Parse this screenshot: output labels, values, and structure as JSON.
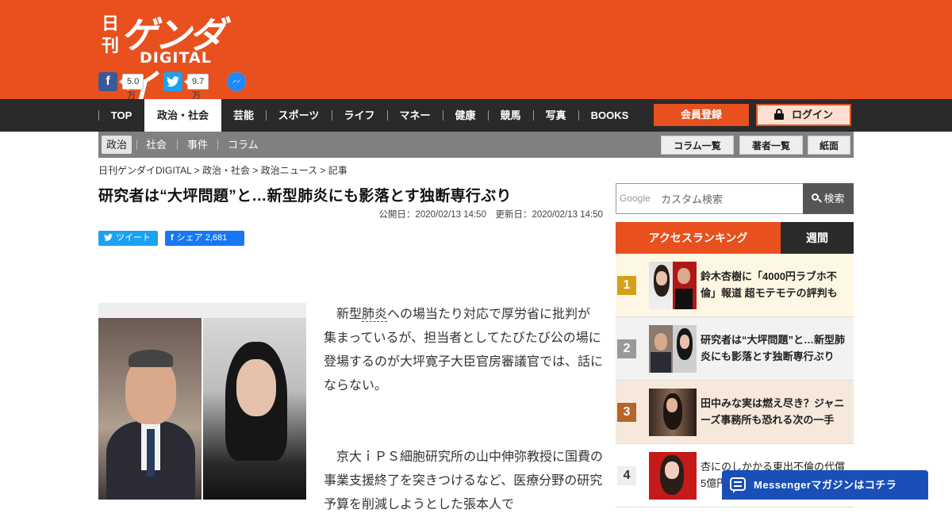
{
  "brand": {
    "logo_kan": "日刊",
    "logo_gendai": "ゲンダイ",
    "logo_digital": "DIGITAL"
  },
  "social": {
    "facebook_count": "5.0万",
    "twitter_count": "9.7万"
  },
  "nav": {
    "items": [
      "TOP",
      "政治・社会",
      "芸能",
      "スポーツ",
      "ライフ",
      "マネー",
      "健康",
      "競馬",
      "写真",
      "BOOKS"
    ],
    "active": "政治・社会",
    "register_label": "会員登録",
    "login_label": "ログイン"
  },
  "subnav": {
    "items": [
      "政治",
      "社会",
      "事件",
      "コラム"
    ],
    "active": "政治",
    "buttons": [
      "コラム一覧",
      "著者一覧",
      "紙面"
    ]
  },
  "breadcrumb": "日刊ゲンダイDIGITAL > 政治・社会 > 政治ニュース > 記事",
  "article": {
    "title": "研究者は“大坪問題”と…新型肺炎にも影落とす独断専行ぶり",
    "dates": "公開日：2020/02/13 14:50　更新日：2020/02/13 14:50",
    "share_tweet": "ツイート",
    "share_fb": "シェア 2,681",
    "p1_pre": "新型",
    "p1_dotted": "肺炎",
    "p1_post": "への場当たり対応で厚労省に批判が集まっているが、担当者としてたびたび公の場に登場するのが大坪寛子大臣官房審議官では、話にならない。",
    "p2": "京大ｉＰＳ細胞研究所の山中伸弥教授に国費の事業支援終了を突きつけるなど、医療分野の研究予算を削減しようとした張本人で"
  },
  "search": {
    "google_label": "Google",
    "placeholder": "カスタム検索",
    "button_label": "検索"
  },
  "ranking": {
    "tab_access": "アクセスランキング",
    "tab_weekly": "週間",
    "items": [
      {
        "rank": "1",
        "title": "鈴木杏樹に「4000円ラブホ不倫」報道 超モテモテの評判も"
      },
      {
        "rank": "2",
        "title": "研究者は“大坪問題”と…新型肺炎にも影落とす独断専行ぶり"
      },
      {
        "rank": "3",
        "title": "田中みな実は燃え尽き？ジャニーズ事務所も恐れる次の一手"
      },
      {
        "rank": "4",
        "title": "杏にのしかかる東出不倫の代償5億円"
      }
    ],
    "colors": {
      "rank1": "#d4a017",
      "rank2": "#999999",
      "rank3": "#b5652b",
      "rank4": "#eeeeee"
    }
  },
  "messenger": {
    "label": "Messengerマガジンはコチラ"
  },
  "colors": {
    "brand_orange": "#e8501e",
    "nav_dark": "#2a2a2a",
    "subnav_gray": "#808080",
    "messenger_blue": "#1a4fb8"
  }
}
